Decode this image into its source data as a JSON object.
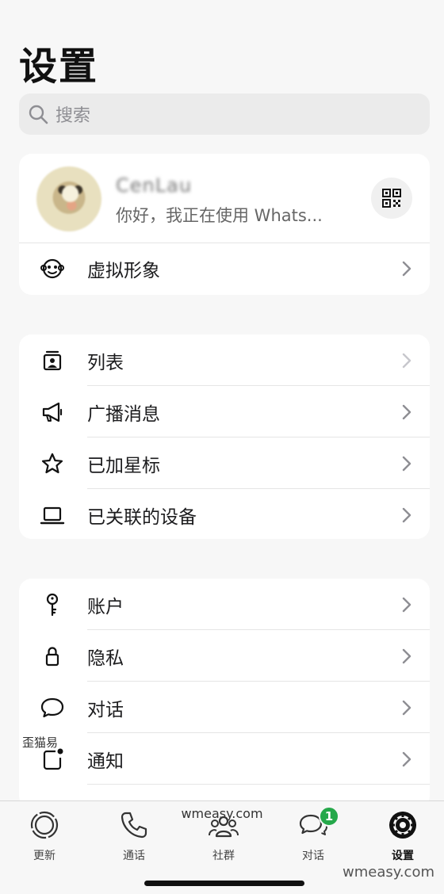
{
  "page": {
    "title": "设置"
  },
  "search": {
    "placeholder": "搜索"
  },
  "profile": {
    "name": "CenLau",
    "status": "你好，我正在使用 Whats...",
    "avatar_row_label": "虚拟形象"
  },
  "group1": {
    "items": [
      {
        "label": "列表",
        "icon": "list-contact-icon"
      },
      {
        "label": "广播消息",
        "icon": "megaphone-icon"
      },
      {
        "label": "已加星标",
        "icon": "star-icon"
      },
      {
        "label": "已关联的设备",
        "icon": "laptop-icon"
      }
    ]
  },
  "group2": {
    "items": [
      {
        "label": "账户",
        "icon": "key-icon"
      },
      {
        "label": "隐私",
        "icon": "lock-icon"
      },
      {
        "label": "对话",
        "icon": "chat-bubble-icon"
      },
      {
        "label": "通知",
        "icon": "notification-icon"
      }
    ]
  },
  "tabs": [
    {
      "label": "更新",
      "icon": "updates-icon"
    },
    {
      "label": "通话",
      "icon": "phone-icon"
    },
    {
      "label": "社群",
      "icon": "community-icon"
    },
    {
      "label": "对话",
      "icon": "chats-icon",
      "badge": "1"
    },
    {
      "label": "设置",
      "icon": "settings-gear-icon",
      "active": true
    }
  ],
  "watermarks": {
    "left": "歪猫易",
    "center": "wmeasy.com",
    "corner": "wmeasy.com"
  },
  "colors": {
    "badge": "#25a84a",
    "background": "#f7f7f7"
  }
}
